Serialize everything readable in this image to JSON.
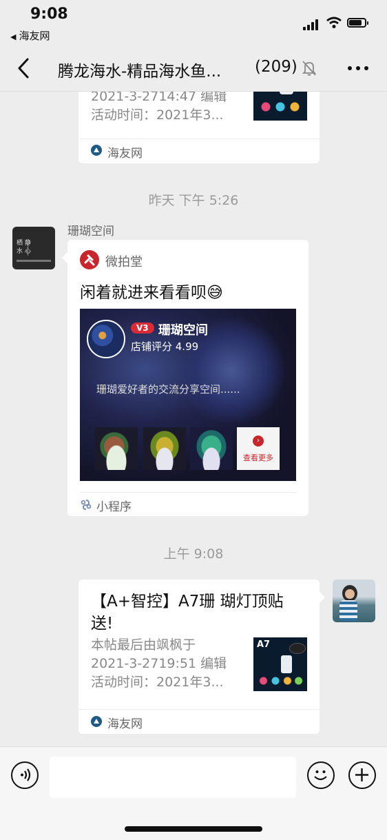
{
  "status_bar": {
    "time": "9:08",
    "back_app": "海友网"
  },
  "nav": {
    "title": "腾龙海水-精品海水鱼...",
    "member_count": "(209)"
  },
  "messages": {
    "top_card": {
      "sub_line1": "2021-3-2714:47 编辑",
      "sub_line2": "活动时间：2021年3...",
      "source": "海友网"
    },
    "timestamp1": "昨天 下午 5:26",
    "coral_msg": {
      "sender": "珊瑚空间",
      "app_name": "微拍堂",
      "text": "闲着就进来看看呗",
      "emoji": "😅",
      "shop_badge": "V3",
      "shop_name": "珊瑚空间",
      "shop_rating": "店铺评分 4.99",
      "shop_desc": "珊瑚爱好者的交流分享空间......",
      "view_more": "查看更多",
      "source": "小程序"
    },
    "timestamp2": "上午 9:08",
    "a7_card": {
      "title_line1": "【A+智控】A7珊 瑚灯顶贴",
      "title_line2": "送!",
      "sub_line1": "本帖最后由飒枫于",
      "sub_line2": "2021-3-2719:51 编辑",
      "sub_line3": "活动时间：2021年3...",
      "thumb_label": "A7",
      "source": "海友网"
    }
  },
  "colors": {
    "background": "#ededed",
    "weipaitang_red": "#c8262c",
    "badge_red": "#d92b35"
  }
}
